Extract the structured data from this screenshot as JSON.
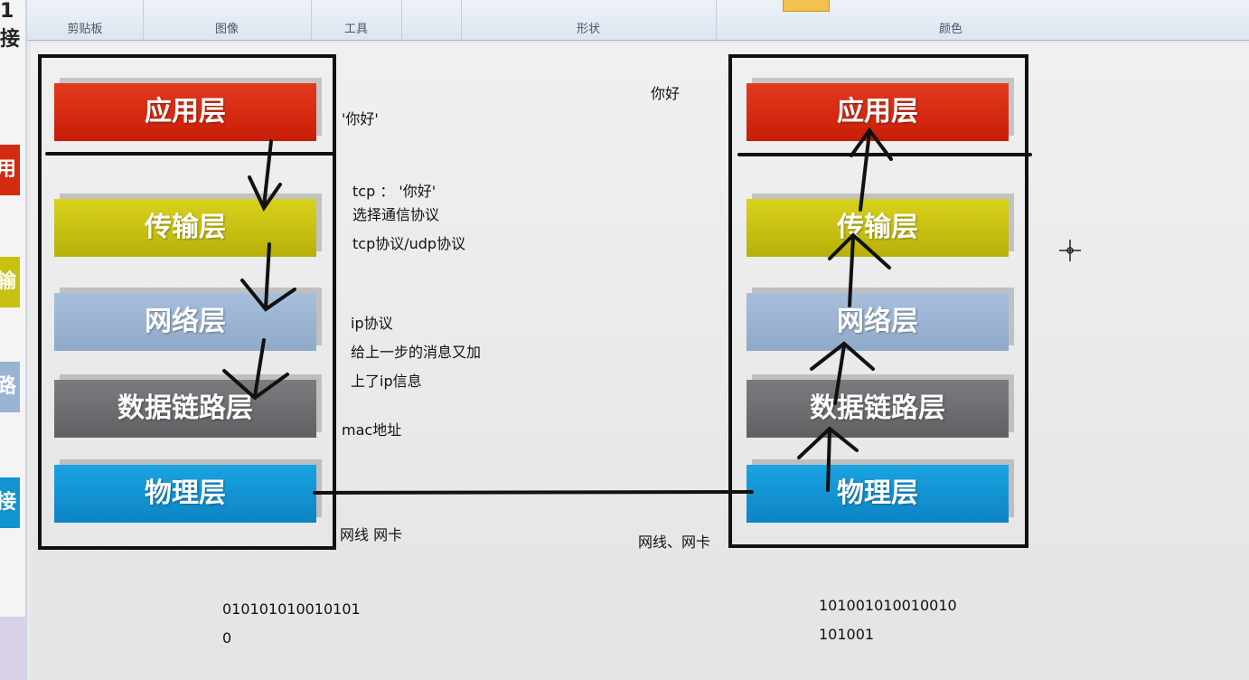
{
  "ribbon": {
    "groups": [
      "剪贴板",
      "图像",
      "工具",
      "形状",
      "颜色"
    ]
  },
  "left_strip": {
    "top_char": "1接",
    "tabs": [
      "用",
      "输",
      "路",
      "接"
    ]
  },
  "left_stack": {
    "layers": [
      "应用层",
      "传输层",
      "网络层",
      "数据链路层",
      "物理层"
    ]
  },
  "right_stack": {
    "layers": [
      "应用层",
      "传输层",
      "网络层",
      "数据链路层",
      "物理层"
    ]
  },
  "annotations": {
    "app_left": "'你好'",
    "app_right": "你好",
    "tcp_line1": "tcp ：  '你好'",
    "tcp_line2": "选择通信协议",
    "tcp_line3": "tcp协议/udp协议",
    "ip_line1": "ip协议",
    "ip_line2": "给上一步的消息又加",
    "ip_line3": "上了ip信息",
    "mac": "mac地址",
    "phys_left": "网线 网卡",
    "phys_right": "网线、网卡",
    "bits_left_1": "010101010010101",
    "bits_left_2": "0",
    "bits_right_1": "101001010010010",
    "bits_right_2": "101001"
  },
  "colors": {
    "app": "#d42a10",
    "transport": "#c8c112",
    "network": "#9ab3d2",
    "datalink": "#6e6c70",
    "physical": "#1293d2",
    "ink": "#111111"
  },
  "icons": [
    "crosshair-cursor-icon"
  ]
}
